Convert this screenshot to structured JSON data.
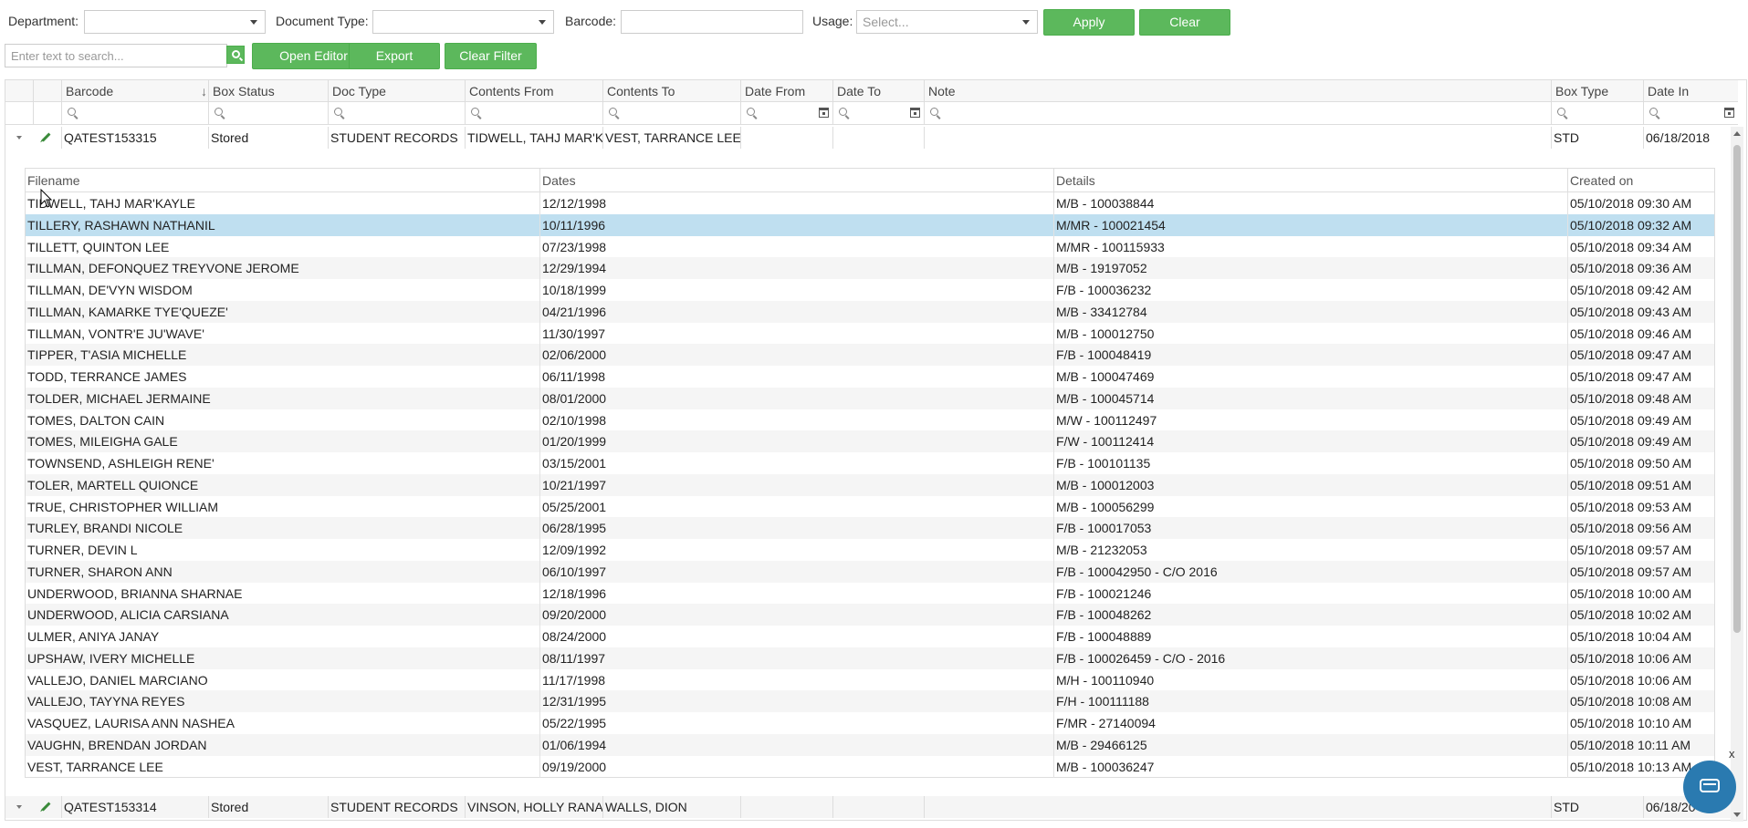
{
  "filters": {
    "department_label": "Department:",
    "doctype_label": "Document Type:",
    "barcode_label": "Barcode:",
    "usage_label": "Usage:",
    "usage_placeholder": "Select...",
    "apply": "Apply",
    "clear": "Clear"
  },
  "toolbar": {
    "search_placeholder": "Enter text to search...",
    "open_editor": "Open Editor",
    "export": "Export",
    "clear_filter": "Clear Filter"
  },
  "grid": {
    "columns": [
      "Barcode",
      "Box Status",
      "Doc Type",
      "Contents From",
      "Contents To",
      "Date From",
      "Date To",
      "Note",
      "Box Type",
      "Date In"
    ],
    "rows": [
      {
        "barcode": "QATEST153315",
        "status": "Stored",
        "doctype": "STUDENT RECORDS",
        "from": "TIDWELL, TAHJ MAR'K",
        "to": "VEST, TARRANCE LEE",
        "date_from": "",
        "date_to": "",
        "note": "",
        "box_type": "STD",
        "date_in": "06/18/2018"
      },
      {
        "barcode": "QATEST153314",
        "status": "Stored",
        "doctype": "STUDENT RECORDS",
        "from": "VINSON, HOLLY RANA",
        "to": "WALLS, DION",
        "date_from": "",
        "date_to": "",
        "note": "",
        "box_type": "STD",
        "date_in": "06/18/20"
      }
    ]
  },
  "detail": {
    "columns": [
      "Filename",
      "Dates",
      "Details",
      "Created on"
    ],
    "rows": [
      [
        "TIDWELL, TAHJ MAR'KAYLE",
        "12/12/1998",
        "M/B - 100038844",
        "05/10/2018 09:30 AM"
      ],
      [
        "TILLERY, RASHAWN NATHANIL",
        "10/11/1996",
        "M/MR - 100021454",
        "05/10/2018 09:32 AM"
      ],
      [
        "TILLETT, QUINTON LEE",
        "07/23/1998",
        "M/MR - 100115933",
        "05/10/2018 09:34 AM"
      ],
      [
        "TILLMAN, DEFONQUEZ TREYVONE JEROME",
        "12/29/1994",
        "M/B - 19197052",
        "05/10/2018 09:36 AM"
      ],
      [
        "TILLMAN, DE'VYN WISDOM",
        "10/18/1999",
        "F/B - 100036232",
        "05/10/2018 09:42 AM"
      ],
      [
        "TILLMAN, KAMARKE TYE'QUEZE'",
        "04/21/1996",
        "M/B - 33412784",
        "05/10/2018 09:43 AM"
      ],
      [
        "TILLMAN, VONTR'E JU'WAVE'",
        "11/30/1997",
        "M/B - 100012750",
        "05/10/2018 09:46 AM"
      ],
      [
        "TIPPER, T'ASIA MICHELLE",
        "02/06/2000",
        "F/B - 100048419",
        "05/10/2018 09:47 AM"
      ],
      [
        "TODD, TERRANCE JAMES",
        "06/11/1998",
        "M/B - 100047469",
        "05/10/2018 09:47 AM"
      ],
      [
        "TOLDER, MICHAEL JERMAINE",
        "08/01/2000",
        "M/B - 100045714",
        "05/10/2018 09:48 AM"
      ],
      [
        "TOMES, DALTON CAIN",
        "02/10/1998",
        "M/W - 100112497",
        "05/10/2018 09:49 AM"
      ],
      [
        "TOMES, MILEIGHA GALE",
        "01/20/1999",
        "F/W - 100112414",
        "05/10/2018 09:49 AM"
      ],
      [
        "TOWNSEND, ASHLEIGH RENE'",
        "03/15/2001",
        "F/B - 100101135",
        "05/10/2018 09:50 AM"
      ],
      [
        "TOLER, MARTELL QUIONCE",
        "10/21/1997",
        "M/B - 100012003",
        "05/10/2018 09:51 AM"
      ],
      [
        "TRUE, CHRISTOPHER WILLIAM",
        "05/25/2001",
        "M/B - 100056299",
        "05/10/2018 09:53 AM"
      ],
      [
        "TURLEY, BRANDI NICOLE",
        "06/28/1995",
        "F/B - 100017053",
        "05/10/2018 09:56 AM"
      ],
      [
        "TURNER, DEVIN L",
        "12/09/1992",
        "M/B - 21232053",
        "05/10/2018 09:57 AM"
      ],
      [
        "TURNER, SHARON ANN",
        "06/10/1997",
        "F/B - 100042950 - C/O 2016",
        "05/10/2018 09:57 AM"
      ],
      [
        "UNDERWOOD, BRIANNA SHARNAE",
        "12/18/1996",
        "F/B - 100021246",
        "05/10/2018 10:00 AM"
      ],
      [
        "UNDERWOOD, ALICIA CARSIANA",
        "09/20/2000",
        "F/B - 100048262",
        "05/10/2018 10:02 AM"
      ],
      [
        "ULMER, ANIYA JANAY",
        "08/24/2000",
        "F/B - 100048889",
        "05/10/2018 10:04 AM"
      ],
      [
        "UPSHAW, IVERY MICHELLE",
        "08/11/1997",
        "F/B - 100026459 - C/O - 2016",
        "05/10/2018 10:06 AM"
      ],
      [
        "VALLEJO, DANIEL MARCIANO",
        "11/17/1998",
        "M/H - 100110940",
        "05/10/2018 10:06 AM"
      ],
      [
        "VALLEJO, TAYYNA REYES",
        "12/31/1995",
        "F/H - 100111188",
        "05/10/2018 10:08 AM"
      ],
      [
        "VASQUEZ, LAURISA ANN NASHEA",
        "05/22/1995",
        "F/MR - 27140094",
        "05/10/2018 10:10 AM"
      ],
      [
        "VAUGHN, BRENDAN JORDAN",
        "01/06/1994",
        "M/B - 29466125",
        "05/10/2018 10:11 AM"
      ],
      [
        "VEST, TARRANCE LEE",
        "09/19/2000",
        "M/B - 100036247",
        "05/10/2018 10:13 AM"
      ]
    ],
    "selected_row": 1
  },
  "chat_close": "x",
  "colors": {
    "accent": "#5cb85c",
    "selected": "#bfdff0",
    "chat": "#2a7ab0"
  }
}
